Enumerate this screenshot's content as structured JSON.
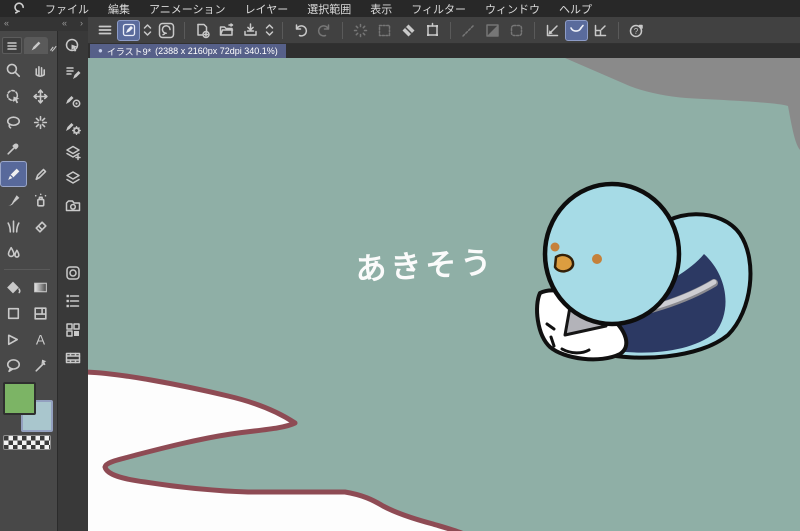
{
  "app": {
    "name": "Clip Studio Paint",
    "menu_items": [
      "ファイル",
      "編集",
      "アニメーション",
      "レイヤー",
      "選択範囲",
      "表示",
      "フィルター",
      "ウィンドウ",
      "ヘルプ"
    ]
  },
  "toolbar": {
    "icons": [
      "main-menu",
      "current-tool-object",
      "tool-expand",
      "clip-studio",
      "new-file",
      "open-file",
      "save",
      "save-expand",
      "undo",
      "redo",
      "deselect",
      "reselect",
      "clear-selection",
      "transform-frame",
      "snap-line",
      "snap-perspective",
      "snap-frame",
      "snap-to-ruler",
      "snap-to-special-ruler",
      "snap-to-grid",
      "support"
    ],
    "active_icons": [
      "current-tool-object",
      "snap-to-special-ruler"
    ],
    "disabled_icons": [
      "redo",
      "deselect",
      "reselect",
      "snap-line",
      "snap-perspective",
      "snap-frame"
    ]
  },
  "document_tab": {
    "indicator": "●",
    "title": "イラスト9*",
    "details": "(2388 x 2160px 72dpi 340.1%)"
  },
  "tool_palette": {
    "tools": [
      "zoom",
      "hand",
      "rotate-canvas",
      "move-layer",
      "lasso",
      "auto-select",
      "eyedropper",
      "pen",
      "pencil",
      "brush",
      "airbrush",
      "decoration",
      "eraser",
      "blend",
      "fill",
      "gradient",
      "figure",
      "frame-border",
      "polyline",
      "text",
      "balloon",
      "correct-line"
    ],
    "selected_tool": "pen",
    "foreground_color": "#7cb465",
    "background_color": "#a9c6cd",
    "transparent_swatch": "checkered"
  },
  "palette_strip": {
    "icons": [
      "sub-view",
      "sub-tool",
      "tool-property",
      "brush-settings",
      "layer-search",
      "layer",
      "reference",
      "navigator",
      "layer-property",
      "material",
      "timeline"
    ]
  },
  "canvas": {
    "caption": "あきそう",
    "background_color": "#8fafa6",
    "pasteboard_color": "#8a8a8a",
    "shape_outline_color": "#8e4b54",
    "shape_fill_color": "#fdfdfd",
    "bird": {
      "body_color": "#a6dbe6",
      "wing_shadow_color": "#2c3963",
      "chest_color": "#ffffff",
      "beak_color": "#dc9d40",
      "eye_color": "#c5813a",
      "outline_color": "#0d0d0d"
    }
  }
}
